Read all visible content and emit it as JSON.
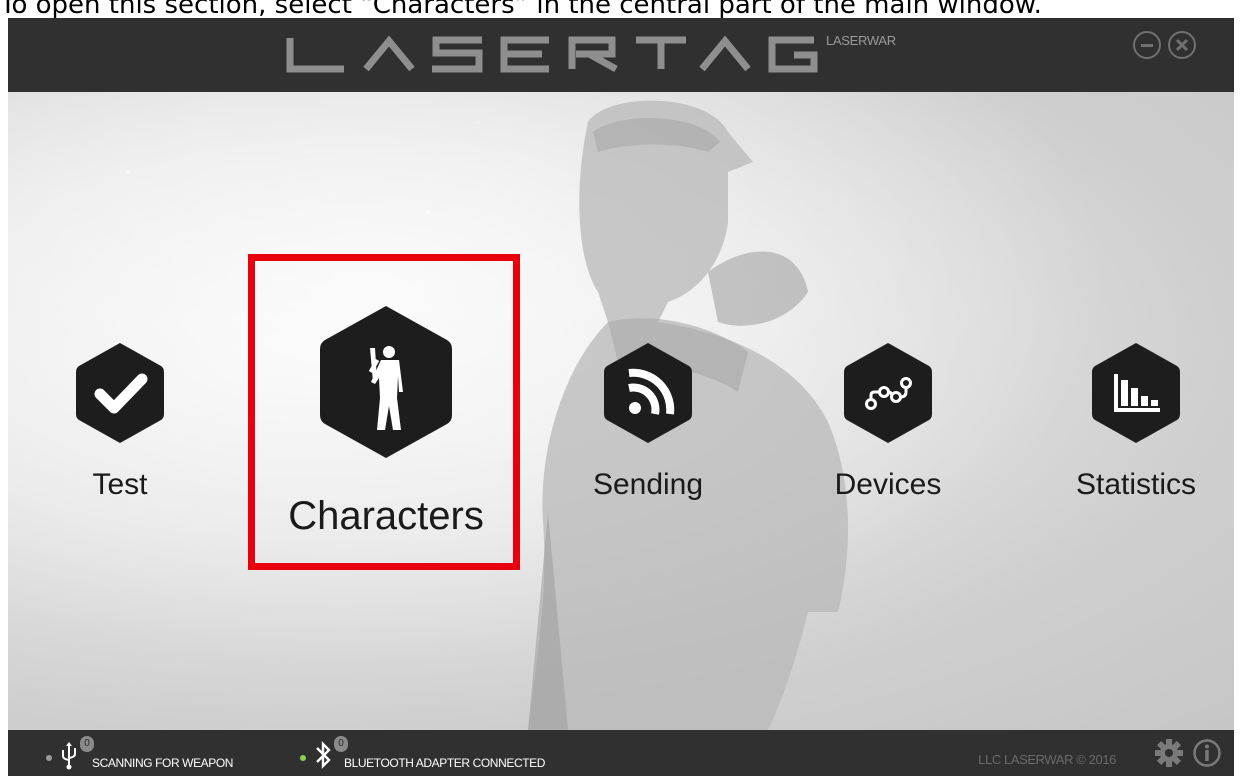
{
  "caption": "To open this section, select “Characters” in the central part of the main window.",
  "titlebar": {
    "logo_text": "LASERTAG",
    "logo_sub": "LASERWAR",
    "minimize_icon": "minimize-icon",
    "close_icon": "close-icon"
  },
  "tiles": [
    {
      "label": "Test",
      "icon": "checkmark-icon"
    },
    {
      "label": "Characters",
      "icon": "soldier-icon"
    },
    {
      "label": "Sending",
      "icon": "rss-icon"
    },
    {
      "label": "Devices",
      "icon": "nodes-icon"
    },
    {
      "label": "Statistics",
      "icon": "bar-chart-icon"
    }
  ],
  "statusbar": {
    "usb_count": "0",
    "usb_status": "SCANNING FOR WEAPON",
    "bt_count": "0",
    "bt_status": "BLUETOOTH ADAPTER CONNECTED",
    "copyright": "LLC LASERWAR © 2016",
    "colors": {
      "usb_dot": "#9a9a9a",
      "bt_dot": "#8fd14f",
      "highlight": "#e8000d"
    }
  }
}
